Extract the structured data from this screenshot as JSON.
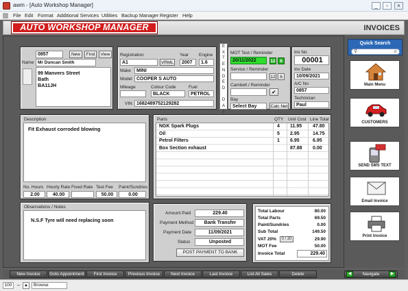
{
  "window": {
    "app_name": "awm",
    "title": "awm - [Auto Workshop Manager]",
    "controls": [
      "_",
      "▫",
      "×"
    ]
  },
  "menubar": [
    "File",
    "Edit",
    "Format",
    "Additional Services",
    "Utilities",
    "Backup Manager",
    "Register",
    "Help"
  ],
  "header": {
    "logo_text": "AUTO WORKSHOP MANAGER",
    "page_title": "INVOICES"
  },
  "customer": {
    "account_no": "0857",
    "buttons": {
      "new": "New",
      "find": "Find",
      "view": "View"
    },
    "name_label": "Name",
    "name": "Mr Duncan Smith",
    "address": [
      "99 Manvers Street",
      "Bath",
      "BA11JH"
    ]
  },
  "vehicle": {
    "labels": {
      "registration": "Registration",
      "year": "Year",
      "engine": "Engine",
      "make": "Make",
      "model": "Model",
      "mileage": "Mileage",
      "colour_code": "Colour Code",
      "fuel": "Fuel",
      "vin": "VIN"
    },
    "registration": "A1",
    "vrml_button": "VRML",
    "year": "2007",
    "engine": "1.6",
    "make": "MINI",
    "model": "COOPER S AUTO",
    "mileage": "",
    "colour_code": "BLACK",
    "fuel": "PETROL",
    "vin": "1682489752129282"
  },
  "extended_data_letters": [
    "E",
    "X",
    "T",
    "E",
    "N",
    "D",
    "E",
    "D",
    "",
    "D",
    "A",
    "T",
    "A"
  ],
  "reminders": {
    "mot_label": "MOT Test / Reminder",
    "mot_date": "20/11/2022",
    "mot_months": "12",
    "mot_extra": "6",
    "service_label": "Service / Reminder",
    "service_months": "12",
    "service_extra": "6",
    "cambelt_label": "Cambelt / Reminder",
    "cambelt_check": "✔",
    "bay_label": "Bay",
    "bay": "Select Bay",
    "calc_net_button": "Calc Net"
  },
  "invoice": {
    "no_label": "Inv No",
    "number": "00001",
    "date_label": "Inv Date",
    "date": "10/09/2021",
    "ac_label": "A/C No",
    "account": "0857",
    "tech_label": "Technician",
    "technician": "Paul"
  },
  "description": {
    "label": "Description",
    "text": "Fit Exhaust corroded blowing",
    "labels": {
      "hours": "No. Hours",
      "hourly_rate": "Hourly Rate",
      "fixed_rate": "Fixed Rate",
      "test_fee": "Test Fee",
      "paint": "Paint/Sundries"
    },
    "values": {
      "hours": "2.00",
      "hourly_rate": "40.00",
      "fixed_rate": "",
      "test_fee": "50.00",
      "paint": "0.00"
    }
  },
  "parts": {
    "headers": {
      "parts": "Parts",
      "qty": "QTY",
      "unit_cost": "Unit Cost",
      "line_total": "Line Total"
    },
    "rows": [
      {
        "name": "NGK Spark Plugs",
        "qty": "4",
        "unit": "11.95",
        "total": "47.80"
      },
      {
        "name": "Oil",
        "qty": "5",
        "unit": "2.95",
        "total": "14.75"
      },
      {
        "name": "Petrol Filters",
        "qty": "1",
        "unit": "6.95",
        "total": "6.95"
      },
      {
        "name": "Box Section exhaust",
        "qty": "",
        "unit": "87.88",
        "total": "0.00"
      }
    ]
  },
  "observations": {
    "label": "Observations / Notes",
    "text": "N.S.F Tyre will need replacing soon"
  },
  "payment": {
    "amount_label": "Amount Paid",
    "amount": "229.40",
    "method_label": "Payment Method",
    "method": "Bank Transfer",
    "date_label": "Payment Date",
    "date": "11/09/2021",
    "status_label": "Status",
    "status": "Unposted",
    "post_button": "POST PAYMENT TO BANK"
  },
  "totals": {
    "labour_label": "Total Labour",
    "labour": "80.00",
    "parts_label": "Total Parts",
    "parts": "69.50",
    "paint_label": "Paint/Sundries",
    "paint": "0.00",
    "subtotal_label": "Sub Total",
    "subtotal": "149.50",
    "vat_label": "VAT 20%",
    "vat_toggle": "0 / 20",
    "vat": "29.90",
    "mot_label": "MOT Fee",
    "mot": "50.00",
    "invoice_total_label": "Invoice Total",
    "invoice_total": "229.40"
  },
  "sidebar": {
    "search_label": "Quick Search",
    "main_menu": "Main Menu",
    "customers": "CUSTOMERS",
    "send_sms": "SEND SMS TEXT",
    "email_invoice": "Email Invoice",
    "print_invoice": "Print Invoice"
  },
  "bottom_nav": {
    "buttons": [
      "New Invoice",
      "Goto Appointment",
      "First Invoice",
      "Previous Invoice",
      "Next Invoice",
      "Last Invoice",
      "List All Sales",
      "Delete"
    ],
    "navigate": "Navigate"
  },
  "statusbar": {
    "zoom": "100",
    "mode": "Browse"
  },
  "watermark": "Softwa...",
  "colors": {
    "accent_red": "#d11d1d",
    "green": "#2fdd2f",
    "panel": "#cfcfcf",
    "background": "#5a5a5a"
  }
}
